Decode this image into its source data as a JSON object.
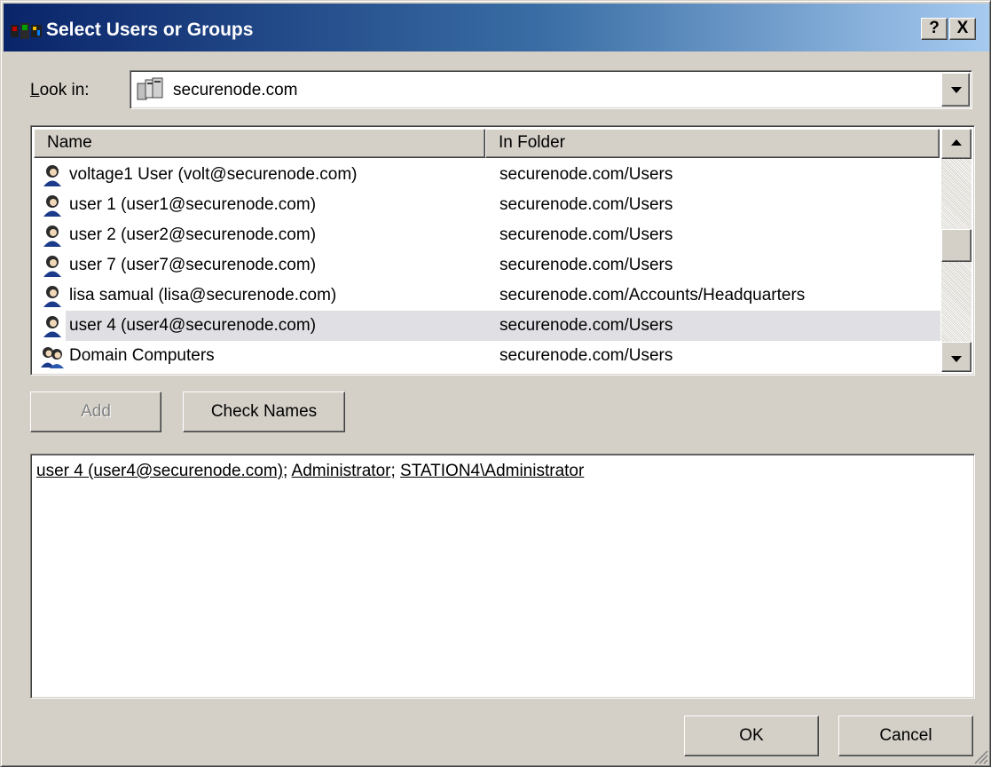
{
  "window": {
    "title": "Select Users or Groups",
    "help_button": "?",
    "close_button": "X"
  },
  "lookin": {
    "label": "Look in:",
    "value": "securenode.com"
  },
  "list": {
    "columns": [
      "Name",
      "In Folder"
    ],
    "rows": [
      {
        "name": "voltage1 User (volt@securenode.com)",
        "folder": "securenode.com/Users",
        "icon": "user-icon"
      },
      {
        "name": "user 1 (user1@securenode.com)",
        "folder": "securenode.com/Users",
        "icon": "user-icon"
      },
      {
        "name": "user 2 (user2@securenode.com)",
        "folder": "securenode.com/Users",
        "icon": "user-icon"
      },
      {
        "name": "user 7 (user7@securenode.com)",
        "folder": "securenode.com/Users",
        "icon": "user-icon"
      },
      {
        "name": "lisa samual (lisa@securenode.com)",
        "folder": "securenode.com/Accounts/Headquarters",
        "icon": "user-icon"
      },
      {
        "name": "user 4 (user4@securenode.com)",
        "folder": "securenode.com/Users",
        "icon": "user-icon",
        "selected": true
      },
      {
        "name": "Domain Computers",
        "folder": "securenode.com/Users",
        "icon": "group-icon"
      }
    ]
  },
  "buttons": {
    "add": "Add",
    "check_names": "Check Names",
    "ok": "OK",
    "cancel": "Cancel"
  },
  "selected_names": {
    "items": [
      "user 4 (user4@securenode.com)",
      "Administrator",
      "STATION4\\Administrator"
    ],
    "separator": "; "
  },
  "colors": {
    "title_gradient_start": "#0a246a",
    "title_gradient_end": "#a6caf0",
    "face": "#d4d0c8",
    "selection": "#e0dfe3"
  }
}
